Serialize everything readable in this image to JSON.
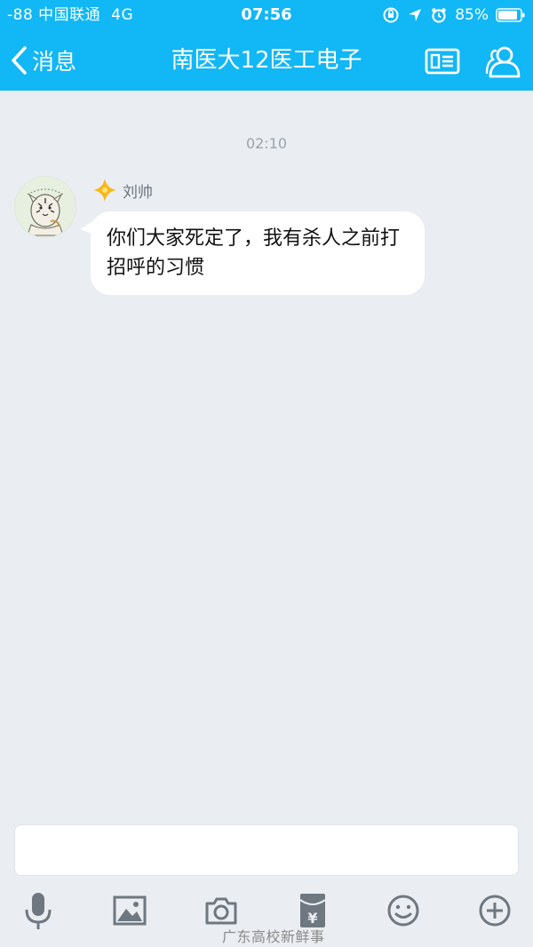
{
  "status_bar": {
    "carrier": "-88 中国联通",
    "network": "4G",
    "time": "07:56",
    "battery": "85%"
  },
  "nav": {
    "back_label": "消息",
    "title": "南医大12医工电子"
  },
  "chat": {
    "timestamp": "02:10",
    "messages": [
      {
        "sender": "刘帅",
        "text": "你们大家死定了，我有杀人之前打招呼的习惯"
      }
    ]
  },
  "input": {
    "value": ""
  },
  "toolbar": {
    "items": [
      "microphone-icon",
      "image-icon",
      "camera-icon",
      "red-packet-icon",
      "emoji-icon",
      "plus-icon"
    ]
  },
  "watermark": "广东高校新鲜事",
  "colors": {
    "accent": "#12b7f5",
    "background": "#eaedf1",
    "bubble": "#ffffff",
    "icon_gray": "#6f7780"
  }
}
